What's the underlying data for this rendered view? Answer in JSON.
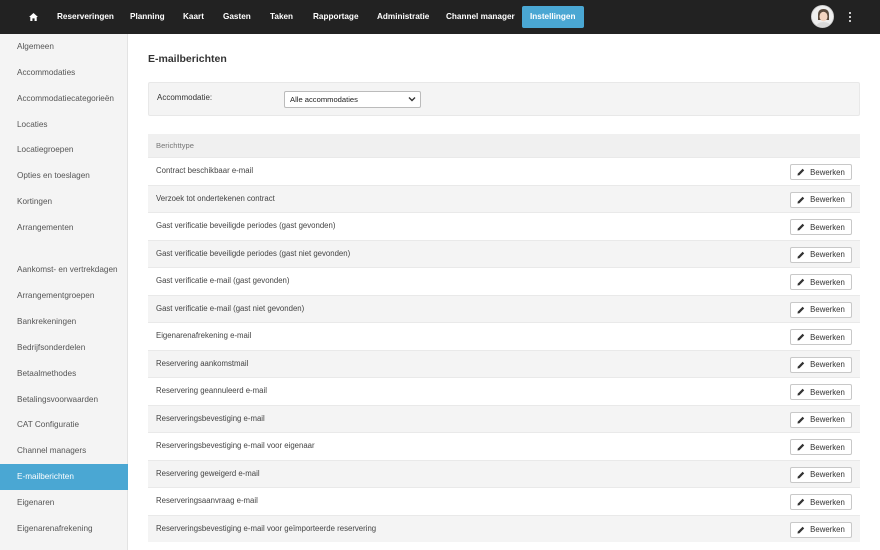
{
  "nav": {
    "home_icon": "home-icon",
    "items": [
      {
        "label": "Reserveringen"
      },
      {
        "label": "Planning"
      },
      {
        "label": "Kaart"
      },
      {
        "label": "Gasten"
      },
      {
        "label": "Taken"
      },
      {
        "label": "Rapportage"
      },
      {
        "label": "Administratie"
      },
      {
        "label": "Channel manager"
      },
      {
        "label": "Instellingen",
        "active": true
      }
    ],
    "accent_color": "#4aa7d3"
  },
  "sidebar": {
    "items": [
      {
        "label": "Algemeen"
      },
      {
        "label": "Accommodaties"
      },
      {
        "label": "Accommodatiecategorieën"
      },
      {
        "label": "Locaties"
      },
      {
        "label": "Locatiegroepen"
      },
      {
        "label": "Opties en toeslagen"
      },
      {
        "label": "Kortingen"
      },
      {
        "label": "Arrangementen"
      },
      {
        "label": "Aankomst- en vertrekdagen"
      },
      {
        "label": "Arrangementgroepen"
      },
      {
        "label": "Bankrekeningen"
      },
      {
        "label": "Bedrijfsonderdelen"
      },
      {
        "label": "Betaalmethodes"
      },
      {
        "label": "Betalingsvoorwaarden"
      },
      {
        "label": "CAT Configuratie"
      },
      {
        "label": "Channel managers"
      },
      {
        "label": "E-mailberichten",
        "active": true
      },
      {
        "label": "Eigenaren"
      },
      {
        "label": "Eigenarenafrekening"
      }
    ]
  },
  "main": {
    "title": "E-mailberichten",
    "filter": {
      "label": "Accommodatie:",
      "selected": "Alle accommodaties"
    },
    "table": {
      "header": "Berichttype",
      "edit_label": "Bewerken",
      "rows": [
        "Contract beschikbaar e-mail",
        "Verzoek tot ondertekenen contract",
        "Gast verificatie beveiligde periodes (gast gevonden)",
        "Gast verificatie beveiligde periodes (gast niet gevonden)",
        "Gast verificatie e-mail (gast gevonden)",
        "Gast verificatie e-mail (gast niet gevonden)",
        "Eigenarenafrekening e-mail",
        "Reservering aankomstmail",
        "Reservering geannuleerd e-mail",
        "Reserveringsbevestiging e-mail",
        "Reserveringsbevestiging e-mail voor eigenaar",
        "Reservering geweigerd e-mail",
        "Reserveringsaanvraag e-mail",
        "Reserveringsbevestiging e-mail voor geïmporteerde reservering"
      ]
    }
  }
}
